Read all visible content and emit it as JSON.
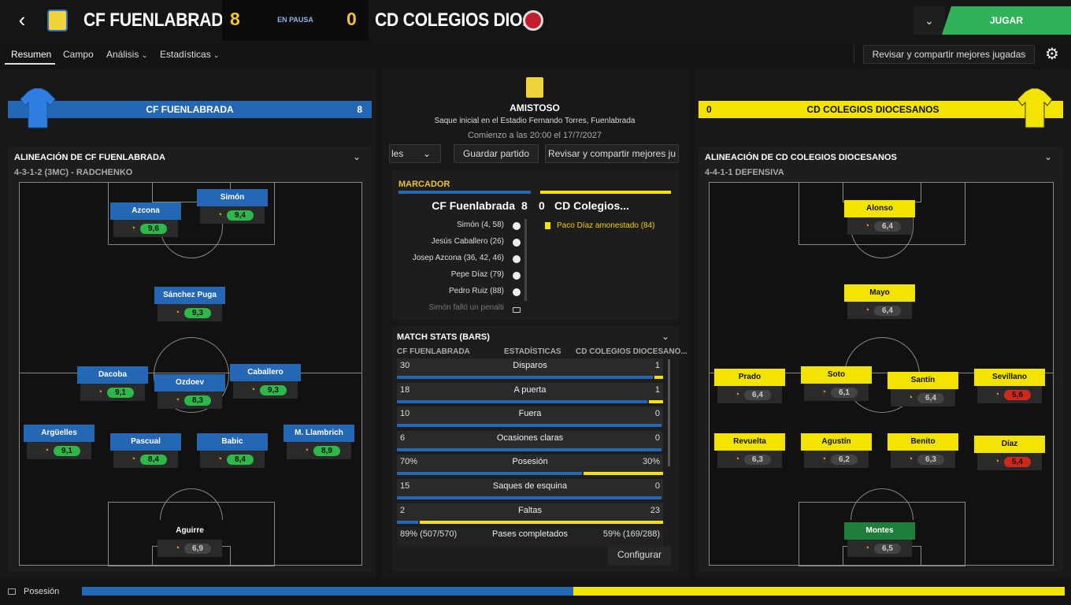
{
  "header": {
    "home_name": "CF FUENLABRADA",
    "home_score": "8",
    "status": "EN PAUSA",
    "away_score": "0",
    "away_name": "CD COLEGIOS DIO...",
    "play_label": "JUGAR"
  },
  "nav": {
    "tabs": [
      "Resumen",
      "Campo",
      "Análisis",
      "Estadísticas"
    ],
    "review_label": "Revisar y compartir mejores jugadas"
  },
  "home": {
    "bar_name": "CF FUENLABRADA",
    "bar_score": "8",
    "lineup_title": "ALINEACIÓN DE CF FUENLABRADA",
    "formation": "4-3-1-2 (3MC) - RADCHENKO",
    "players": [
      {
        "name": "Simón",
        "rating": "9,4"
      },
      {
        "name": "Azcona",
        "rating": "9,6"
      },
      {
        "name": "Sánchez Puga",
        "rating": "9,3"
      },
      {
        "name": "Dacoba",
        "rating": "9,1"
      },
      {
        "name": "Ozdoev",
        "rating": "8,3"
      },
      {
        "name": "Caballero",
        "rating": "9,3"
      },
      {
        "name": "Argüelles",
        "rating": "9,1"
      },
      {
        "name": "Pascual",
        "rating": "8,4"
      },
      {
        "name": "Babic",
        "rating": "8,4"
      },
      {
        "name": "M. Llambrich",
        "rating": "8,9"
      },
      {
        "name": "Aguirre",
        "rating": "6,9"
      }
    ]
  },
  "away": {
    "bar_name": "CD COLEGIOS DIOCESANOS",
    "bar_score": "0",
    "lineup_title": "ALINEACIÓN DE CD COLEGIOS DIOCESANOS",
    "formation": "4-4-1-1 DEFENSIVA",
    "players": [
      {
        "name": "Alonso",
        "rating": "6,4"
      },
      {
        "name": "Mayo",
        "rating": "6,4"
      },
      {
        "name": "Prado",
        "rating": "6,4"
      },
      {
        "name": "Soto",
        "rating": "6,1"
      },
      {
        "name": "Santín",
        "rating": "6,4"
      },
      {
        "name": "Sevillano",
        "rating": "5,6"
      },
      {
        "name": "Revuelta",
        "rating": "6,3"
      },
      {
        "name": "Agustín",
        "rating": "6,2"
      },
      {
        "name": "Benito",
        "rating": "6,3"
      },
      {
        "name": "Díaz",
        "rating": "5,4"
      },
      {
        "name": "Montes",
        "rating": "6,5"
      }
    ]
  },
  "match": {
    "competition": "AMISTOSO",
    "venue": "Saque inicial en el Estadio Fernando Torres, Fuenlabrada",
    "kickoff": "Comienzo a las 20:00 el 17/7/2027",
    "dropdown_label": "les",
    "save_label": "Guardar partido",
    "review_label": "Revisar y compartir mejores ju"
  },
  "scoreboard": {
    "title": "MARCADOR",
    "home_team": "CF Fuenlabrada",
    "home_goals": "8",
    "away_goals": "0",
    "away_team": "CD Colegios...",
    "home_events": [
      "Simón (4, 58)",
      "Jesús Caballero (26)",
      "Josep Azcona (36, 42, 46)",
      "Pepe Díaz (79)",
      "Pedro Ruiz (88)",
      "Simón falló un penalti"
    ],
    "away_events": [
      "Paco Díaz amonestado (84)"
    ]
  },
  "stats": {
    "title": "MATCH STATS (BARS)",
    "col_home": "CF FUENLABRADA",
    "col_mid": "ESTADÍSTICAS",
    "col_away": "CD COLEGIOS DIOCESANO...",
    "rows": [
      {
        "home": "30",
        "label": "Disparos",
        "away": "1",
        "home_frac": 0.968
      },
      {
        "home": "18",
        "label": "A puerta",
        "away": "1",
        "home_frac": 0.947
      },
      {
        "home": "10",
        "label": "Fuera",
        "away": "0",
        "home_frac": 1.0
      },
      {
        "home": "6",
        "label": "Ocasiones claras",
        "away": "0",
        "home_frac": 1.0
      },
      {
        "home": "70%",
        "label": "Posesión",
        "away": "30%",
        "home_frac": 0.7
      },
      {
        "home": "15",
        "label": "Saques de esquina",
        "away": "0",
        "home_frac": 1.0
      },
      {
        "home": "2",
        "label": "Faltas",
        "away": "23",
        "home_frac": 0.08
      }
    ],
    "passes": {
      "home": "89% (507/570)",
      "label": "Pases completados",
      "away": "59% (169/288)"
    },
    "configure_label": "Configurar"
  },
  "bottom": {
    "label": "Posesión",
    "home_possession": 0.5
  },
  "colors": {
    "home": "#2467b5",
    "away": "#f2e400",
    "play": "#2fb25a"
  }
}
